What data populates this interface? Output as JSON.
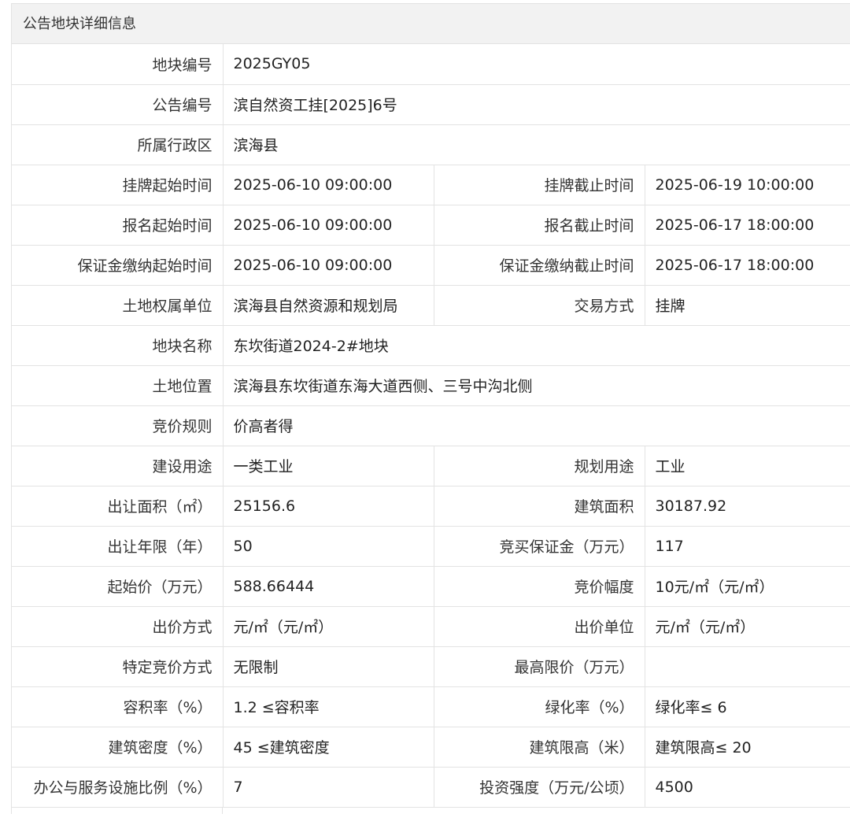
{
  "panel": {
    "title": "公告地块详细信息"
  },
  "rows": [
    {
      "l1": "地块编号",
      "v1": "2025GY05"
    },
    {
      "l1": "公告编号",
      "v1": "滨自然资工挂[2025]6号"
    },
    {
      "l1": "所属行政区",
      "v1": "滨海县"
    },
    {
      "l1": "挂牌起始时间",
      "v1": "2025-06-10 09:00:00",
      "l2": "挂牌截止时间",
      "v2": "2025-06-19 10:00:00"
    },
    {
      "l1": "报名起始时间",
      "v1": "2025-06-10 09:00:00",
      "l2": "报名截止时间",
      "v2": "2025-06-17 18:00:00"
    },
    {
      "l1": "保证金缴纳起始时间",
      "v1": "2025-06-10 09:00:00",
      "l2": "保证金缴纳截止时间",
      "v2": "2025-06-17 18:00:00"
    },
    {
      "l1": "土地权属单位",
      "v1": "滨海县自然资源和规划局",
      "l2": "交易方式",
      "v2": "挂牌"
    },
    {
      "l1": "地块名称",
      "v1": "东坎街道2024-2#地块"
    },
    {
      "l1": "土地位置",
      "v1": "滨海县东坎街道东海大道西侧、三号中沟北侧"
    },
    {
      "l1": "竞价规则",
      "v1": "价高者得"
    },
    {
      "l1": "建设用途",
      "v1": "一类工业",
      "l2": "规划用途",
      "v2": "工业"
    },
    {
      "l1": "出让面积（㎡）",
      "v1": "25156.6",
      "l2": "建筑面积",
      "v2": "30187.92"
    },
    {
      "l1": "出让年限（年）",
      "v1": "50",
      "l2": "竞买保证金（万元）",
      "v2": "117"
    },
    {
      "l1": "起始价（万元）",
      "v1": "588.66444",
      "l2": "竞价幅度",
      "v2": "10元/㎡（元/㎡）"
    },
    {
      "l1": "出价方式",
      "v1": "元/㎡（元/㎡）",
      "l2": "出价单位",
      "v2": "元/㎡（元/㎡）"
    },
    {
      "l1": "特定竞价方式",
      "v1": "无限制",
      "l2": "最高限价（万元）",
      "v2": ""
    },
    {
      "l1": "容积率（%）",
      "v1": "1.2 ≤容积率",
      "l2": "绿化率（%）",
      "v2": "绿化率≤ 6"
    },
    {
      "l1": "建筑密度（%）",
      "v1": "45 ≤建筑密度",
      "l2": "建筑限高（米）",
      "v2": "建筑限高≤ 20"
    },
    {
      "l1": "办公与服务设施比例（%）",
      "v1": "7",
      "l2": "投资强度（万元/公顷）",
      "v2": "4500"
    }
  ]
}
